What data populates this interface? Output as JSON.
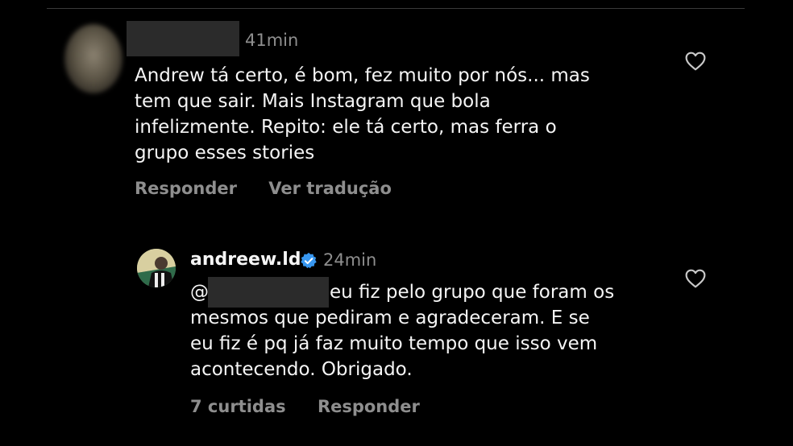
{
  "comment1": {
    "time": "41min",
    "lines": "Andrew tá certo, é bom, fez muito por nós... mas\ntem que sair. Mais Instagram que bola\ninfelizmente. Repito: ele tá certo, mas ferra o\ngrupo esses stories",
    "reply_label": "Responder",
    "translate_label": "Ver tradução",
    "like_icon": "heart-outline"
  },
  "comment2": {
    "username": "andreew.ld",
    "verified_icon": "verified-badge",
    "time": "24min",
    "mention_prefix": "@",
    "first_line": "eu fiz pelo grupo que foram os",
    "lines": "mesmos que pediram e agradeceram. E se\neu fiz é pq já faz muito tempo que isso vem\nacontecendo. Obrigado.",
    "likes_label": "7 curtidas",
    "reply_label": "Responder",
    "like_icon": "heart-outline"
  },
  "colors": {
    "background": "#000000",
    "primary_text": "#f5f5f5",
    "secondary_text": "#8e8e8e",
    "verified_blue": "#3897f0"
  }
}
